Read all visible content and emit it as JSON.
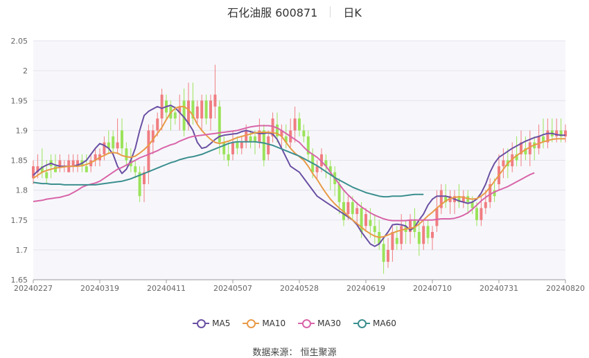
{
  "header": {
    "stock": "石化油服 600871",
    "period": "日K"
  },
  "source": {
    "label": "数据来源：",
    "name": "恒生聚源"
  },
  "colors": {
    "up": "#f07d81",
    "down": "#9be35a",
    "ma5": "#6a4fa3",
    "ma10": "#e89a46",
    "ma30": "#d864a8",
    "ma60": "#3b8e8e"
  },
  "chart_data": {
    "type": "candlestick",
    "ylim": [
      1.65,
      2.05
    ],
    "y_ticks": [
      "1.65",
      "1.7",
      "1.75",
      "1.8",
      "1.85",
      "1.9",
      "1.95",
      "2",
      "2.05"
    ],
    "x_ticks": [
      {
        "i": 0,
        "label": "20240227"
      },
      {
        "i": 15,
        "label": "20240319"
      },
      {
        "i": 30,
        "label": "20240411"
      },
      {
        "i": 45,
        "label": "20240507"
      },
      {
        "i": 60,
        "label": "20240528"
      },
      {
        "i": 75,
        "label": "20240619"
      },
      {
        "i": 90,
        "label": "20240710"
      },
      {
        "i": 105,
        "label": "20240731"
      },
      {
        "i": 120,
        "label": "20240820"
      }
    ],
    "ohlc": [
      [
        1.82,
        1.84,
        1.81,
        1.85
      ],
      [
        1.83,
        1.84,
        1.82,
        1.86
      ],
      [
        1.84,
        1.83,
        1.82,
        1.87
      ],
      [
        1.83,
        1.82,
        1.81,
        1.85
      ],
      [
        1.85,
        1.84,
        1.82,
        1.86
      ],
      [
        1.84,
        1.83,
        1.83,
        1.86
      ],
      [
        1.84,
        1.85,
        1.83,
        1.86
      ],
      [
        1.84,
        1.84,
        1.83,
        1.85
      ],
      [
        1.83,
        1.85,
        1.83,
        1.86
      ],
      [
        1.84,
        1.85,
        1.83,
        1.86
      ],
      [
        1.84,
        1.85,
        1.83,
        1.86
      ],
      [
        1.85,
        1.84,
        1.83,
        1.86
      ],
      [
        1.84,
        1.83,
        1.83,
        1.86
      ],
      [
        1.84,
        1.85,
        1.83,
        1.86
      ],
      [
        1.85,
        1.86,
        1.84,
        1.87
      ],
      [
        1.85,
        1.86,
        1.84,
        1.87
      ],
      [
        1.86,
        1.88,
        1.85,
        1.89
      ],
      [
        1.88,
        1.87,
        1.86,
        1.9
      ],
      [
        1.89,
        1.87,
        1.86,
        1.9
      ],
      [
        1.87,
        1.88,
        1.86,
        1.92
      ],
      [
        1.9,
        1.87,
        1.86,
        1.92
      ],
      [
        1.87,
        1.85,
        1.84,
        1.88
      ],
      [
        1.85,
        1.84,
        1.83,
        1.87
      ],
      [
        1.84,
        1.83,
        1.82,
        1.85
      ],
      [
        1.83,
        1.79,
        1.78,
        1.84
      ],
      [
        1.81,
        1.83,
        1.78,
        1.84
      ],
      [
        1.83,
        1.9,
        1.81,
        1.91
      ],
      [
        1.88,
        1.9,
        1.86,
        1.91
      ],
      [
        1.9,
        1.92,
        1.89,
        1.93
      ],
      [
        1.92,
        1.96,
        1.9,
        1.97
      ],
      [
        1.95,
        1.93,
        1.92,
        1.96
      ],
      [
        1.94,
        1.92,
        1.9,
        1.95
      ],
      [
        1.93,
        1.92,
        1.91,
        1.94
      ],
      [
        1.93,
        1.94,
        1.9,
        1.96
      ],
      [
        1.95,
        1.9,
        1.89,
        1.97
      ],
      [
        1.91,
        1.95,
        1.9,
        1.98
      ],
      [
        1.95,
        1.92,
        1.91,
        1.98
      ],
      [
        1.92,
        1.94,
        1.91,
        1.95
      ],
      [
        1.92,
        1.95,
        1.9,
        1.96
      ],
      [
        1.95,
        1.92,
        1.91,
        1.96
      ],
      [
        1.92,
        1.95,
        1.9,
        1.96
      ],
      [
        1.94,
        1.96,
        1.92,
        2.01
      ],
      [
        1.94,
        1.88,
        1.86,
        1.95
      ],
      [
        1.88,
        1.86,
        1.85,
        1.89
      ],
      [
        1.86,
        1.85,
        1.84,
        1.88
      ],
      [
        1.86,
        1.88,
        1.85,
        1.9
      ],
      [
        1.88,
        1.87,
        1.86,
        1.89
      ],
      [
        1.87,
        1.88,
        1.86,
        1.89
      ],
      [
        1.88,
        1.9,
        1.87,
        1.91
      ],
      [
        1.89,
        1.88,
        1.87,
        1.9
      ],
      [
        1.89,
        1.88,
        1.86,
        1.9
      ],
      [
        1.88,
        1.9,
        1.87,
        1.92
      ],
      [
        1.9,
        1.85,
        1.84,
        1.91
      ],
      [
        1.86,
        1.89,
        1.85,
        1.9
      ],
      [
        1.89,
        1.92,
        1.88,
        1.93
      ],
      [
        1.91,
        1.89,
        1.88,
        1.93
      ],
      [
        1.89,
        1.9,
        1.87,
        1.91
      ],
      [
        1.89,
        1.88,
        1.87,
        1.91
      ],
      [
        1.88,
        1.9,
        1.87,
        1.92
      ],
      [
        1.9,
        1.92,
        1.88,
        1.94
      ],
      [
        1.92,
        1.9,
        1.89,
        1.93
      ],
      [
        1.9,
        1.89,
        1.88,
        1.91
      ],
      [
        1.89,
        1.86,
        1.85,
        1.9
      ],
      [
        1.86,
        1.83,
        1.82,
        1.87
      ],
      [
        1.83,
        1.84,
        1.82,
        1.85
      ],
      [
        1.84,
        1.86,
        1.83,
        1.87
      ],
      [
        1.85,
        1.84,
        1.82,
        1.86
      ],
      [
        1.84,
        1.83,
        1.8,
        1.85
      ],
      [
        1.83,
        1.81,
        1.79,
        1.84
      ],
      [
        1.81,
        1.78,
        1.76,
        1.82
      ],
      [
        1.78,
        1.75,
        1.74,
        1.8
      ],
      [
        1.76,
        1.78,
        1.75,
        1.79
      ],
      [
        1.78,
        1.76,
        1.75,
        1.79
      ],
      [
        1.76,
        1.77,
        1.74,
        1.78
      ],
      [
        1.77,
        1.73,
        1.72,
        1.78
      ],
      [
        1.74,
        1.76,
        1.73,
        1.77
      ],
      [
        1.75,
        1.74,
        1.72,
        1.77
      ],
      [
        1.74,
        1.73,
        1.71,
        1.76
      ],
      [
        1.73,
        1.71,
        1.7,
        1.75
      ],
      [
        1.71,
        1.68,
        1.66,
        1.72
      ],
      [
        1.68,
        1.7,
        1.67,
        1.72
      ],
      [
        1.7,
        1.73,
        1.68,
        1.74
      ],
      [
        1.72,
        1.71,
        1.7,
        1.74
      ],
      [
        1.71,
        1.74,
        1.7,
        1.76
      ],
      [
        1.74,
        1.73,
        1.71,
        1.75
      ],
      [
        1.73,
        1.75,
        1.71,
        1.76
      ],
      [
        1.75,
        1.73,
        1.72,
        1.77
      ],
      [
        1.73,
        1.71,
        1.69,
        1.75
      ],
      [
        1.71,
        1.74,
        1.7,
        1.75
      ],
      [
        1.74,
        1.72,
        1.71,
        1.75
      ],
      [
        1.72,
        1.73,
        1.7,
        1.74
      ],
      [
        1.74,
        1.77,
        1.73,
        1.8
      ],
      [
        1.77,
        1.8,
        1.76,
        1.81
      ],
      [
        1.79,
        1.78,
        1.77,
        1.81
      ],
      [
        1.78,
        1.79,
        1.76,
        1.8
      ],
      [
        1.78,
        1.79,
        1.76,
        1.8
      ],
      [
        1.79,
        1.78,
        1.77,
        1.81
      ],
      [
        1.78,
        1.79,
        1.77,
        1.8
      ],
      [
        1.79,
        1.78,
        1.76,
        1.8
      ],
      [
        1.78,
        1.77,
        1.76,
        1.79
      ],
      [
        1.77,
        1.75,
        1.74,
        1.78
      ],
      [
        1.75,
        1.77,
        1.74,
        1.79
      ],
      [
        1.77,
        1.78,
        1.76,
        1.8
      ],
      [
        1.78,
        1.81,
        1.77,
        1.82
      ],
      [
        1.8,
        1.79,
        1.78,
        1.82
      ],
      [
        1.81,
        1.84,
        1.8,
        1.86
      ],
      [
        1.84,
        1.85,
        1.82,
        1.87
      ],
      [
        1.85,
        1.84,
        1.82,
        1.87
      ],
      [
        1.84,
        1.86,
        1.83,
        1.88
      ],
      [
        1.86,
        1.85,
        1.84,
        1.89
      ],
      [
        1.86,
        1.88,
        1.84,
        1.9
      ],
      [
        1.87,
        1.86,
        1.85,
        1.89
      ],
      [
        1.86,
        1.88,
        1.84,
        1.9
      ],
      [
        1.88,
        1.87,
        1.85,
        1.89
      ],
      [
        1.87,
        1.89,
        1.86,
        1.91
      ],
      [
        1.89,
        1.88,
        1.87,
        1.92
      ],
      [
        1.88,
        1.9,
        1.87,
        1.92
      ],
      [
        1.9,
        1.89,
        1.88,
        1.92
      ],
      [
        1.89,
        1.9,
        1.88,
        1.92
      ],
      [
        1.9,
        1.89,
        1.88,
        1.92
      ],
      [
        1.89,
        1.9,
        1.88,
        1.91
      ]
    ],
    "series": [
      {
        "name": "MA5",
        "key": "ma5",
        "values": [
          1.825,
          1.832,
          1.838,
          1.842,
          1.845,
          1.842,
          1.84,
          1.84,
          1.84,
          1.84,
          1.842,
          1.845,
          1.85,
          1.86,
          1.87,
          1.878,
          1.875,
          1.87,
          1.86,
          1.84,
          1.828,
          1.835,
          1.85,
          1.87,
          1.9,
          1.925,
          1.932,
          1.936,
          1.94,
          1.937,
          1.94,
          1.942,
          1.938,
          1.93,
          1.922,
          1.912,
          1.9,
          1.88,
          1.87,
          1.872,
          1.878,
          1.885,
          1.89,
          1.892,
          1.893,
          1.894,
          1.895,
          1.898,
          1.9,
          1.898,
          1.896,
          1.895,
          1.895,
          1.896,
          1.894,
          1.885,
          1.87,
          1.855,
          1.84,
          1.835,
          1.83,
          1.82,
          1.81,
          1.8,
          1.79,
          1.785,
          1.78,
          1.775,
          1.77,
          1.765,
          1.76,
          1.755,
          1.75,
          1.742,
          1.73,
          1.72,
          1.71,
          1.706,
          1.71,
          1.72,
          1.73,
          1.742,
          1.743,
          1.742,
          1.74,
          1.733,
          1.738,
          1.75,
          1.76,
          1.775,
          1.785,
          1.79,
          1.79,
          1.79,
          1.788,
          1.785,
          1.782,
          1.78,
          1.778,
          1.78,
          1.785,
          1.795,
          1.81,
          1.83,
          1.845,
          1.855,
          1.86,
          1.865,
          1.87,
          1.874,
          1.878,
          1.882,
          1.885,
          1.888,
          1.89,
          1.893,
          1.895,
          1.895,
          1.893,
          1.892,
          1.892
        ]
      },
      {
        "name": "MA10",
        "key": "ma10",
        "values": [
          1.82,
          1.825,
          1.83,
          1.833,
          1.835,
          1.837,
          1.838,
          1.839,
          1.84,
          1.84,
          1.84,
          1.841,
          1.843,
          1.846,
          1.85,
          1.855,
          1.858,
          1.862,
          1.863,
          1.862,
          1.858,
          1.856,
          1.855,
          1.857,
          1.862,
          1.868,
          1.875,
          1.885,
          1.895,
          1.905,
          1.918,
          1.93,
          1.937,
          1.94,
          1.94,
          1.935,
          1.925,
          1.91,
          1.9,
          1.892,
          1.885,
          1.88,
          1.878,
          1.88,
          1.882,
          1.885,
          1.888,
          1.89,
          1.892,
          1.894,
          1.896,
          1.897,
          1.897,
          1.897,
          1.896,
          1.895,
          1.89,
          1.88,
          1.87,
          1.862,
          1.856,
          1.85,
          1.84,
          1.828,
          1.818,
          1.806,
          1.795,
          1.785,
          1.777,
          1.77,
          1.764,
          1.757,
          1.75,
          1.744,
          1.738,
          1.732,
          1.727,
          1.723,
          1.721,
          1.722,
          1.725,
          1.728,
          1.731,
          1.733,
          1.735,
          1.736,
          1.738,
          1.743,
          1.75,
          1.757,
          1.763,
          1.77,
          1.776,
          1.782,
          1.786,
          1.788,
          1.789,
          1.788,
          1.786,
          1.785,
          1.786,
          1.79,
          1.796,
          1.805,
          1.815,
          1.825,
          1.835,
          1.845,
          1.852,
          1.858,
          1.863,
          1.868,
          1.872,
          1.876,
          1.878,
          1.881,
          1.883,
          1.885,
          1.886,
          1.886,
          1.886
        ]
      },
      {
        "name": "MA30",
        "key": "ma30",
        "values": [
          1.781,
          1.782,
          1.783,
          1.785,
          1.786,
          1.787,
          1.788,
          1.79,
          1.792,
          1.796,
          1.8,
          1.805,
          1.808,
          1.81,
          1.812,
          1.815,
          1.82,
          1.825,
          1.83,
          1.835,
          1.838,
          1.842,
          1.846,
          1.85,
          1.854,
          1.857,
          1.86,
          1.863,
          1.866,
          1.87,
          1.873,
          1.876,
          1.878,
          1.882,
          1.885,
          1.888,
          1.89,
          1.891,
          1.892,
          1.893,
          1.894,
          1.895,
          1.896,
          1.897,
          1.898,
          1.899,
          1.9,
          1.902,
          1.904,
          1.906,
          1.907,
          1.908,
          1.908,
          1.908,
          1.907,
          1.904,
          1.9,
          1.895,
          1.89,
          1.885,
          1.88,
          1.872,
          1.865,
          1.86,
          1.855,
          1.848,
          1.84,
          1.83,
          1.82,
          1.81,
          1.8,
          1.792,
          1.785,
          1.778,
          1.772,
          1.767,
          1.762,
          1.758,
          1.755,
          1.752,
          1.75,
          1.749,
          1.749,
          1.749,
          1.749,
          1.75,
          1.75,
          1.75,
          1.75,
          1.75,
          1.75,
          1.751,
          1.752,
          1.752,
          1.752,
          1.753,
          1.755,
          1.758,
          1.762,
          1.768,
          1.775,
          1.782,
          1.788,
          1.793,
          1.797,
          1.8,
          1.803,
          1.806,
          1.81,
          1.814,
          1.818,
          1.822,
          1.826,
          1.829
        ]
      },
      {
        "name": "MA60",
        "key": "ma60",
        "values": [
          1.813,
          1.812,
          1.811,
          1.811,
          1.81,
          1.81,
          1.81,
          1.809,
          1.809,
          1.809,
          1.809,
          1.809,
          1.809,
          1.809,
          1.809,
          1.81,
          1.811,
          1.812,
          1.813,
          1.814,
          1.815,
          1.817,
          1.819,
          1.822,
          1.825,
          1.828,
          1.831,
          1.834,
          1.837,
          1.84,
          1.843,
          1.846,
          1.848,
          1.851,
          1.853,
          1.855,
          1.856,
          1.858,
          1.86,
          1.863,
          1.866,
          1.869,
          1.872,
          1.875,
          1.878,
          1.88,
          1.881,
          1.881,
          1.881,
          1.881,
          1.881,
          1.88,
          1.879,
          1.877,
          1.875,
          1.872,
          1.869,
          1.866,
          1.863,
          1.86,
          1.857,
          1.853,
          1.849,
          1.845,
          1.841,
          1.836,
          1.831,
          1.826,
          1.821,
          1.817,
          1.813,
          1.809,
          1.805,
          1.802,
          1.799,
          1.796,
          1.794,
          1.792,
          1.79,
          1.789,
          1.789,
          1.79,
          1.79,
          1.79,
          1.791,
          1.792,
          1.793,
          1.793,
          1.793
        ]
      }
    ]
  }
}
